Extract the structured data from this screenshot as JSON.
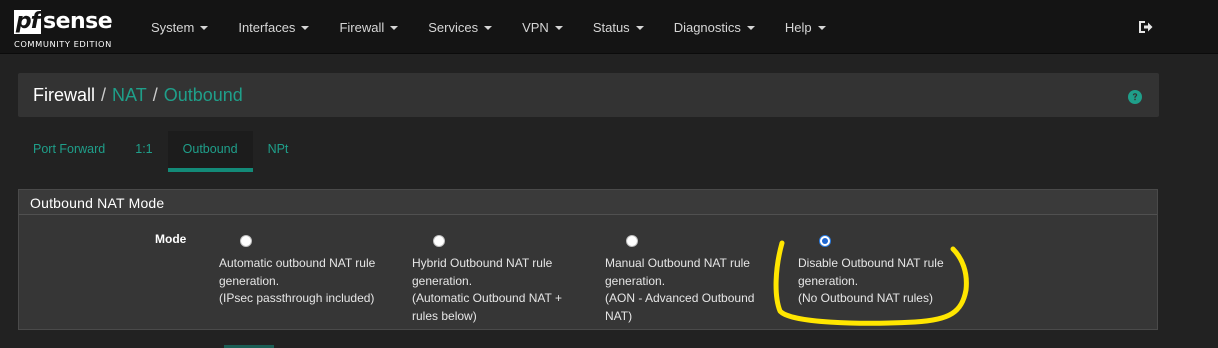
{
  "brand": {
    "logo_pf": "pf",
    "logo_sense": "sense",
    "edition": "COMMUNITY EDITION"
  },
  "nav": {
    "items": [
      {
        "label": "System"
      },
      {
        "label": "Interfaces"
      },
      {
        "label": "Firewall"
      },
      {
        "label": "Services"
      },
      {
        "label": "VPN"
      },
      {
        "label": "Status"
      },
      {
        "label": "Diagnostics"
      },
      {
        "label": "Help"
      }
    ],
    "logout_icon": "sign-out-icon"
  },
  "breadcrumb": {
    "items": [
      "Firewall",
      "NAT",
      "Outbound"
    ],
    "separator": "/",
    "help_icon": "question-circle-icon"
  },
  "tabs": [
    {
      "label": "Port Forward",
      "active": false
    },
    {
      "label": "1:1",
      "active": false
    },
    {
      "label": "Outbound",
      "active": true
    },
    {
      "label": "NPt",
      "active": false
    }
  ],
  "section": {
    "title": "Outbound NAT Mode",
    "field_label": "Mode",
    "options": [
      {
        "lines": [
          "Automatic outbound NAT rule",
          "generation.",
          "(IPsec passthrough included)"
        ],
        "checked": false
      },
      {
        "lines": [
          "Hybrid Outbound NAT rule",
          "generation.",
          "(Automatic Outbound NAT +",
          "rules below)"
        ],
        "checked": false
      },
      {
        "lines": [
          "Manual Outbound NAT rule",
          "generation.",
          "(AON - Advanced Outbound",
          "NAT)"
        ],
        "checked": false
      },
      {
        "lines": [
          "Disable Outbound NAT rule",
          "generation.",
          "(No Outbound NAT rules)"
        ],
        "checked": true
      }
    ]
  },
  "colors": {
    "accent": "#1f9f8a",
    "navbar_bg": "#141414",
    "page_bg": "#222222",
    "annotation": "#ffe600"
  }
}
